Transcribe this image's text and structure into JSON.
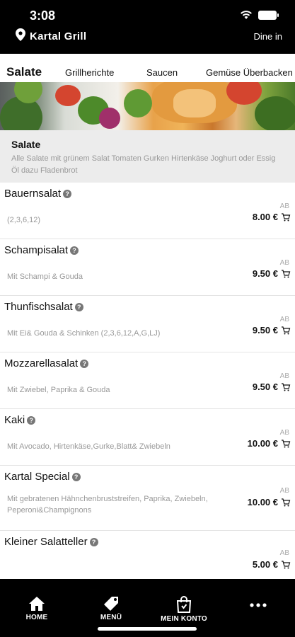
{
  "status_bar": {
    "time": "3:08"
  },
  "header": {
    "location_name": "Kartal Grill",
    "mode": "Dine in"
  },
  "tabs": [
    {
      "label": "Salate",
      "active": true
    },
    {
      "label": "Grillherichte",
      "active": false
    },
    {
      "label": "Saucen",
      "active": false
    },
    {
      "label": "Gemüse Überbacken",
      "active": false
    }
  ],
  "category": {
    "title": "Salate",
    "description": "Alle Salate mit grünem Salat Tomaten Gurken Hirtenkäse Joghurt oder Essig Öl dazu Fladenbrot"
  },
  "items": [
    {
      "name": "Bauernsalat",
      "desc": "(2,3,6,12)",
      "ab": "AB",
      "price": "8.00 €"
    },
    {
      "name": "Schampisalat",
      "desc": "Mit Schampi & Gouda",
      "ab": "AB",
      "price": "9.50 €"
    },
    {
      "name": "Thunfischsalat",
      "desc": "Mit Ei& Gouda & Schinken  (2,3,6,12,A,G,LJ)",
      "ab": "AB",
      "price": "9.50 €"
    },
    {
      "name": "Mozzarellasalat",
      "desc": "Mit Zwiebel, Paprika & Gouda",
      "ab": "AB",
      "price": "9.50 €"
    },
    {
      "name": "Kaki",
      "desc": "Mit Avocado, Hirtenkäse,Gurke,Blatt& Zwiebeln",
      "ab": "AB",
      "price": "10.00 €"
    },
    {
      "name": "Kartal Special",
      "desc": "Mit gebratenen Hähnchenbruststreifen, Paprika, Zwiebeln, Peperoni&Champignons",
      "ab": "AB",
      "price": "10.00 €"
    },
    {
      "name": "Kleiner Salatteller",
      "desc": "",
      "ab": "AB",
      "price": "5.00 €"
    }
  ],
  "bottom_nav": {
    "home": "HOME",
    "menu": "MENÜ",
    "account": "MEIN KONTO"
  },
  "icons": {
    "location": "location-pin-icon",
    "info": "info-icon",
    "cart": "cart-icon",
    "home": "home-icon",
    "menu": "tag-icon",
    "account": "shopping-bag-icon",
    "more": "more-icon"
  }
}
